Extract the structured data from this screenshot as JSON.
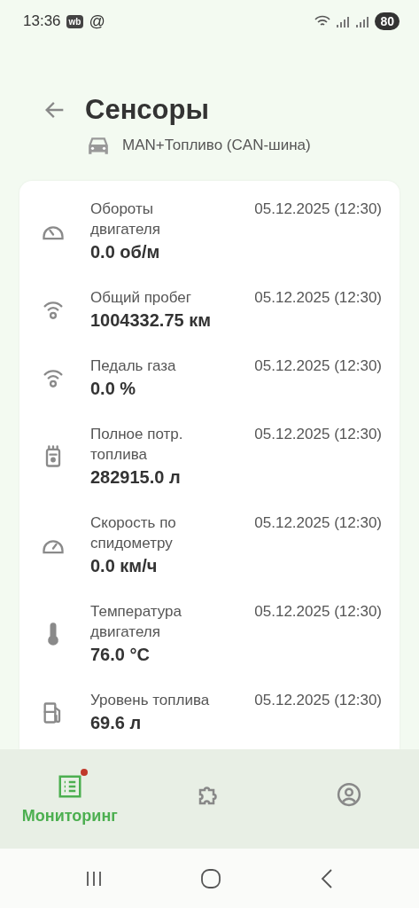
{
  "status_bar": {
    "time": "13:36",
    "app_badge": "wb",
    "mail_symbol": "@",
    "battery": "80"
  },
  "header": {
    "title": "Сенсоры",
    "vehicle": "MAN+Топливо (CAN-шина)"
  },
  "sensors": [
    {
      "kind": "tachometer",
      "label": "Обороты двигателя",
      "value": "0.0 об/м",
      "time": "05.12.2025 (12:30)"
    },
    {
      "kind": "signal",
      "label": "Общий пробег",
      "value": "1004332.75 км",
      "time": "05.12.2025 (12:30)"
    },
    {
      "kind": "signal",
      "label": "Педаль газа",
      "value": "0.0 %",
      "time": "05.12.2025 (12:30)"
    },
    {
      "kind": "fuel-meter",
      "label": "Полное потр. топлива",
      "value": "282915.0 л",
      "time": "05.12.2025 (12:30)"
    },
    {
      "kind": "speedometer",
      "label": "Скорость по спидометру",
      "value": "0.0 км/ч",
      "time": "05.12.2025 (12:30)"
    },
    {
      "kind": "thermometer",
      "label": "Температура двигателя",
      "value": "76.0 °C",
      "time": "05.12.2025 (12:30)"
    },
    {
      "kind": "fuel-pump",
      "label": "Уровень топлива",
      "value": "69.6 л",
      "time": "05.12.2025 (12:30)"
    }
  ],
  "bottom_nav": [
    {
      "kind": "list",
      "label": "Мониторинг",
      "selected": true,
      "notification": true
    },
    {
      "kind": "puzzle",
      "selected": false,
      "notification": false
    },
    {
      "kind": "profile",
      "selected": false,
      "notification": false
    }
  ]
}
